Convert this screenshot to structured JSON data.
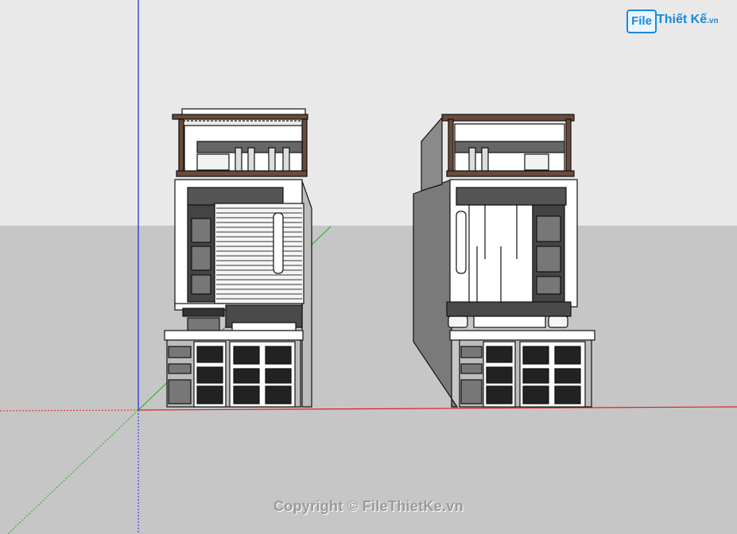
{
  "watermark": {
    "logo_file": "File",
    "logo_brand": "Thiết Kế",
    "logo_domain": ".vn",
    "copyright": "Copyright © FileThietKe.vn"
  },
  "colors": {
    "sky": "#e9e9e9",
    "ground": "#c6c6c6",
    "axis_blue": "#2222dd",
    "axis_red": "#dd2222",
    "axis_green": "#22aa22",
    "accent": "#1a8ad8"
  },
  "scene": {
    "models": [
      "building-front-view",
      "building-side-view"
    ]
  }
}
